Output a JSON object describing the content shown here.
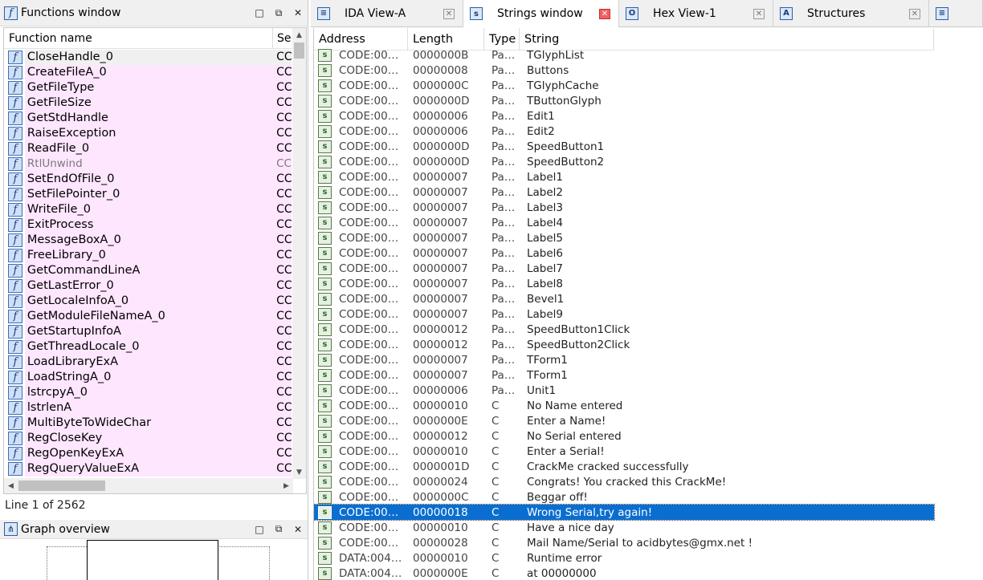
{
  "functions_window": {
    "title": "Functions window",
    "buttons": {
      "restore": "□",
      "float": "⧉",
      "close": "✕"
    },
    "columns": {
      "name": "Function name",
      "segment": "Se"
    },
    "rows": [
      {
        "name": "CloseHandle_0",
        "seg": "CC"
      },
      {
        "name": "CreateFileA_0",
        "seg": "CC"
      },
      {
        "name": "GetFileType",
        "seg": "CC"
      },
      {
        "name": "GetFileSize",
        "seg": "CC"
      },
      {
        "name": "GetStdHandle",
        "seg": "CC"
      },
      {
        "name": "RaiseException",
        "seg": "CC"
      },
      {
        "name": "ReadFile_0",
        "seg": "CC"
      },
      {
        "name": "RtlUnwind",
        "seg": "CC"
      },
      {
        "name": "SetEndOfFile_0",
        "seg": "CC"
      },
      {
        "name": "SetFilePointer_0",
        "seg": "CC"
      },
      {
        "name": "WriteFile_0",
        "seg": "CC"
      },
      {
        "name": "ExitProcess",
        "seg": "CC"
      },
      {
        "name": "MessageBoxA_0",
        "seg": "CC"
      },
      {
        "name": "FreeLibrary_0",
        "seg": "CC"
      },
      {
        "name": "GetCommandLineA",
        "seg": "CC"
      },
      {
        "name": "GetLastError_0",
        "seg": "CC"
      },
      {
        "name": "GetLocaleInfoA_0",
        "seg": "CC"
      },
      {
        "name": "GetModuleFileNameA_0",
        "seg": "CC"
      },
      {
        "name": "GetStartupInfoA",
        "seg": "CC"
      },
      {
        "name": "GetThreadLocale_0",
        "seg": "CC"
      },
      {
        "name": "LoadLibraryExA",
        "seg": "CC"
      },
      {
        "name": "LoadStringA_0",
        "seg": "CC"
      },
      {
        "name": "lstrcpyA_0",
        "seg": "CC"
      },
      {
        "name": "lstrlenA",
        "seg": "CC"
      },
      {
        "name": "MultiByteToWideChar",
        "seg": "CC"
      },
      {
        "name": "RegCloseKey",
        "seg": "CC"
      },
      {
        "name": "RegOpenKeyExA",
        "seg": "CC"
      },
      {
        "name": "RegQueryValueExA",
        "seg": "CC"
      }
    ],
    "status": "Line 1 of 2562"
  },
  "graph_overview": {
    "title": "Graph overview"
  },
  "tabs": [
    {
      "label": "IDA View-A",
      "icon": "ida-view-icon",
      "glyph": "≡",
      "active": false
    },
    {
      "label": "Strings window",
      "icon": "strings-icon",
      "glyph": "s",
      "active": true
    },
    {
      "label": "Hex View-1",
      "icon": "hex-view-icon",
      "glyph": "O",
      "active": false
    },
    {
      "label": "Structures",
      "icon": "structures-icon",
      "glyph": "A",
      "active": false
    },
    {
      "label": "",
      "icon": "enums-icon",
      "glyph": "≡",
      "active": false
    }
  ],
  "tab_close_glyph": "✕",
  "strings_window": {
    "columns": {
      "address": "Address",
      "length": "Length",
      "type": "Type",
      "string": "String"
    },
    "rows": [
      {
        "addr": "CODE:00…",
        "len": "0000000B",
        "type": "Pa…",
        "str": "TGlyphList"
      },
      {
        "addr": "CODE:00…",
        "len": "00000008",
        "type": "Pa…",
        "str": "Buttons"
      },
      {
        "addr": "CODE:00…",
        "len": "0000000C",
        "type": "Pa…",
        "str": "TGlyphCache"
      },
      {
        "addr": "CODE:00…",
        "len": "0000000D",
        "type": "Pa…",
        "str": "TButtonGlyph"
      },
      {
        "addr": "CODE:00…",
        "len": "00000006",
        "type": "Pa…",
        "str": "Edit1"
      },
      {
        "addr": "CODE:00…",
        "len": "00000006",
        "type": "Pa…",
        "str": "Edit2"
      },
      {
        "addr": "CODE:00…",
        "len": "0000000D",
        "type": "Pa…",
        "str": "SpeedButton1"
      },
      {
        "addr": "CODE:00…",
        "len": "0000000D",
        "type": "Pa…",
        "str": "SpeedButton2"
      },
      {
        "addr": "CODE:00…",
        "len": "00000007",
        "type": "Pa…",
        "str": "Label1"
      },
      {
        "addr": "CODE:00…",
        "len": "00000007",
        "type": "Pa…",
        "str": "Label2"
      },
      {
        "addr": "CODE:00…",
        "len": "00000007",
        "type": "Pa…",
        "str": "Label3"
      },
      {
        "addr": "CODE:00…",
        "len": "00000007",
        "type": "Pa…",
        "str": "Label4"
      },
      {
        "addr": "CODE:00…",
        "len": "00000007",
        "type": "Pa…",
        "str": "Label5"
      },
      {
        "addr": "CODE:00…",
        "len": "00000007",
        "type": "Pa…",
        "str": "Label6"
      },
      {
        "addr": "CODE:00…",
        "len": "00000007",
        "type": "Pa…",
        "str": "Label7"
      },
      {
        "addr": "CODE:00…",
        "len": "00000007",
        "type": "Pa…",
        "str": "Label8"
      },
      {
        "addr": "CODE:00…",
        "len": "00000007",
        "type": "Pa…",
        "str": "Bevel1"
      },
      {
        "addr": "CODE:00…",
        "len": "00000007",
        "type": "Pa…",
        "str": "Label9"
      },
      {
        "addr": "CODE:00…",
        "len": "00000012",
        "type": "Pa…",
        "str": "SpeedButton1Click"
      },
      {
        "addr": "CODE:00…",
        "len": "00000012",
        "type": "Pa…",
        "str": "SpeedButton2Click"
      },
      {
        "addr": "CODE:00…",
        "len": "00000007",
        "type": "Pa…",
        "str": "TForm1"
      },
      {
        "addr": "CODE:00…",
        "len": "00000007",
        "type": "Pa…",
        "str": "TForm1"
      },
      {
        "addr": "CODE:00…",
        "len": "00000006",
        "type": "Pa…",
        "str": "Unit1"
      },
      {
        "addr": "CODE:00…",
        "len": "00000010",
        "type": "C",
        "str": "No Name entered"
      },
      {
        "addr": "CODE:00…",
        "len": "0000000E",
        "type": "C",
        "str": "Enter a Name!"
      },
      {
        "addr": "CODE:00…",
        "len": "00000012",
        "type": "C",
        "str": "No Serial entered"
      },
      {
        "addr": "CODE:00…",
        "len": "00000010",
        "type": "C",
        "str": "Enter a Serial!"
      },
      {
        "addr": "CODE:00…",
        "len": "0000001D",
        "type": "C",
        "str": "CrackMe cracked successfully"
      },
      {
        "addr": "CODE:00…",
        "len": "00000024",
        "type": "C",
        "str": "Congrats! You cracked this CrackMe!"
      },
      {
        "addr": "CODE:00…",
        "len": "0000000C",
        "type": "C",
        "str": "Beggar off!"
      },
      {
        "addr": "CODE:00…",
        "len": "00000018",
        "type": "C",
        "str": "Wrong Serial,try again!"
      },
      {
        "addr": "CODE:00…",
        "len": "00000010",
        "type": "C",
        "str": "Have a nice day"
      },
      {
        "addr": "CODE:00…",
        "len": "00000028",
        "type": "C",
        "str": "Mail Name/Serial to acidbytes@gmx.net !"
      },
      {
        "addr": "DATA:004…",
        "len": "00000010",
        "type": "C",
        "str": "Runtime error"
      },
      {
        "addr": "DATA:004…",
        "len": "0000000E",
        "type": "C",
        "str": "  at 00000000"
      }
    ],
    "selected_index": 30
  }
}
